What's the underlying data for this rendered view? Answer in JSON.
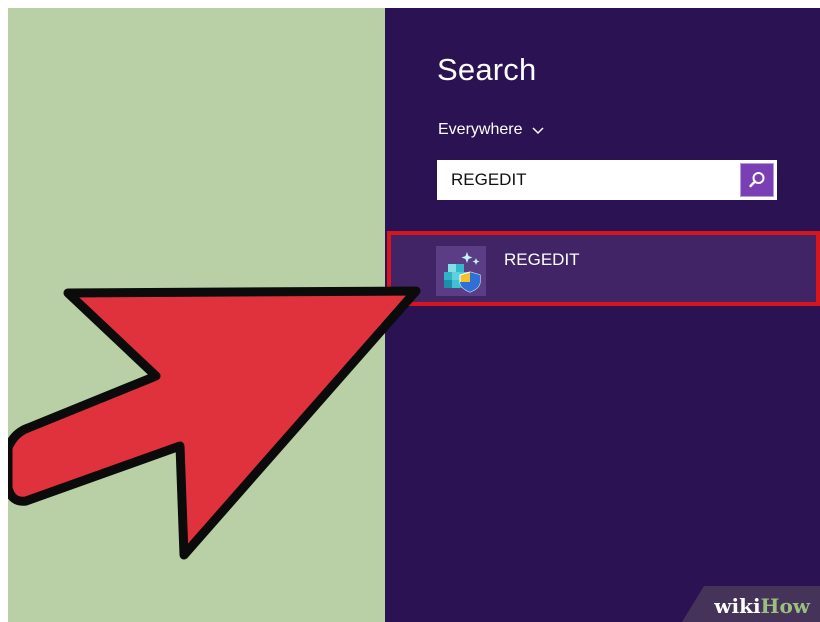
{
  "panel": {
    "title": "Search",
    "scope_label": "Everywhere"
  },
  "search": {
    "value": "REGEDIT"
  },
  "results": [
    {
      "label": "REGEDIT",
      "icon": "registry-editor-icon"
    }
  ],
  "annotations": {
    "arrow_color": "#e0323c",
    "highlight_color": "#d8141d"
  },
  "watermark": {
    "prefix": "wiki",
    "suffix": "How"
  },
  "colors": {
    "panel_bg": "#2b1353",
    "desktop_bg": "#b9d0a6",
    "result_bg": "#412465",
    "search_button": "#7a3fb5"
  }
}
